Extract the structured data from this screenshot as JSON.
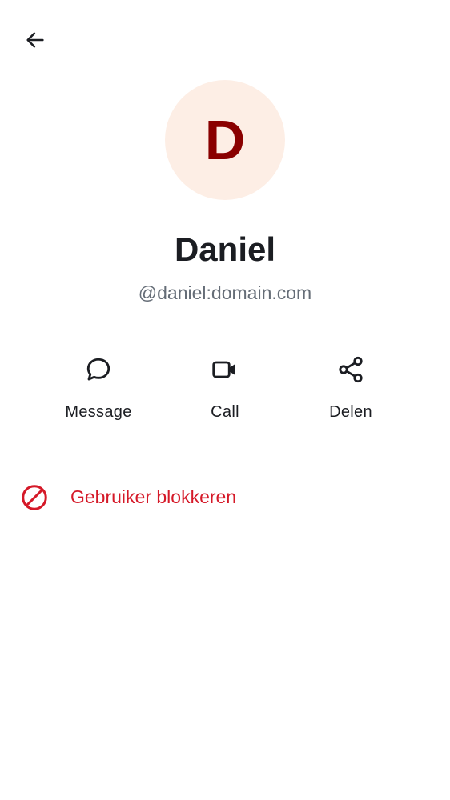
{
  "header": {
    "back_icon": "arrow-left-icon"
  },
  "profile": {
    "avatar_initial": "D",
    "avatar_bg": "#fdeee5",
    "avatar_fg": "#8a0000",
    "display_name": "Daniel",
    "user_id": "@daniel:domain.com"
  },
  "actions": [
    {
      "label": "Message",
      "icon": "chat-bubble-icon"
    },
    {
      "label": "Call",
      "icon": "video-camera-icon"
    },
    {
      "label": "Delen",
      "icon": "share-icon"
    }
  ],
  "block": {
    "label": "Gebruiker blokkeren",
    "icon": "block-icon",
    "color": "#d51928"
  }
}
